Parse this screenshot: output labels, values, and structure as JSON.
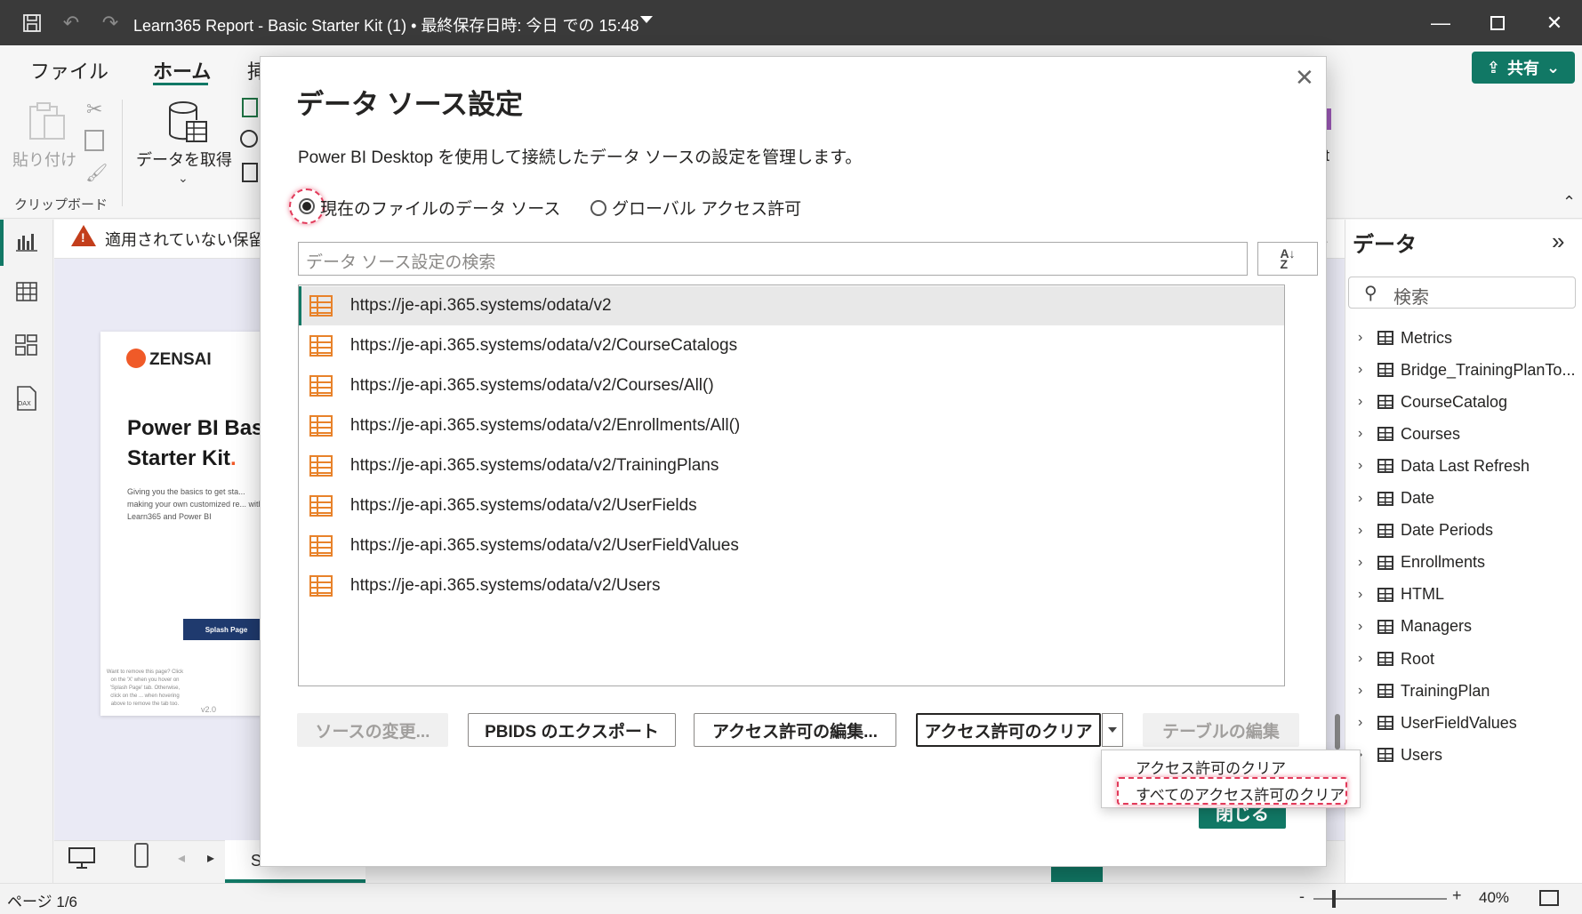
{
  "titlebar": {
    "title": "Learn365 Report - Basic Starter Kit (1) • 最終保存日時: 今日 での 15:48"
  },
  "ribbon": {
    "tabs": [
      "ファイル",
      "ホーム",
      "挿"
    ],
    "paste_label": "貼り付け",
    "get_data_label": "データを取得",
    "clipboard_group": "クリップボード",
    "share_label": "共有",
    "ot_fragment": "ot"
  },
  "canvas": {
    "warning_text": "適用されていない保留",
    "brand": "ZENSAI",
    "report_title_1": "Power BI Bas",
    "report_title_2": "Starter Kit",
    "report_title_dot": ".",
    "description": "Giving you the basics to get sta... making your own customized re... with Learn365 and Power BI",
    "splash_button": "Splash Page",
    "thumb_note": "Want to remove this page? Click on the 'X' when you hover on 'Splash Page' tab. Otherwise, click on the ... when hovering above to remove the tab too.",
    "version": "v2.0"
  },
  "pagebar": {
    "active_tab_fragment": "S"
  },
  "status": {
    "page": "ページ 1/6",
    "zoom": "40%",
    "zoom_fraction": 0.15
  },
  "data_pane": {
    "title": "データ",
    "search_placeholder": "検索",
    "items": [
      {
        "label": "Metrics",
        "icon": "calculator-icon"
      },
      {
        "label": "Bridge_TrainingPlanTo...",
        "icon": "table-icon"
      },
      {
        "label": "CourseCatalog",
        "icon": "table-icon"
      },
      {
        "label": "Courses",
        "icon": "table-icon"
      },
      {
        "label": "Data Last Refresh",
        "icon": "table-icon"
      },
      {
        "label": "Date",
        "icon": "table-icon"
      },
      {
        "label": "Date Periods",
        "icon": "calendar-table-icon"
      },
      {
        "label": "Enrollments",
        "icon": "table-icon"
      },
      {
        "label": "HTML",
        "icon": "table-icon"
      },
      {
        "label": "Managers",
        "icon": "table-icon"
      },
      {
        "label": "Root",
        "icon": "table-icon"
      },
      {
        "label": "TrainingPlan",
        "icon": "table-icon"
      },
      {
        "label": "UserFieldValues",
        "icon": "table-icon"
      },
      {
        "label": "Users",
        "icon": "table-icon"
      }
    ]
  },
  "dialog": {
    "title": "データ ソース設定",
    "description": "Power BI Desktop を使用して接続したデータ ソースの設定を管理します。",
    "radio_current": "現在のファイルのデータ ソース",
    "radio_global": "グローバル アクセス許可",
    "search_placeholder": "データ ソース設定の検索",
    "sources": [
      "https://je-api.365.systems/odata/v2",
      "https://je-api.365.systems/odata/v2/CourseCatalogs",
      "https://je-api.365.systems/odata/v2/Courses/All()",
      "https://je-api.365.systems/odata/v2/Enrollments/All()",
      "https://je-api.365.systems/odata/v2/TrainingPlans",
      "https://je-api.365.systems/odata/v2/UserFields",
      "https://je-api.365.systems/odata/v2/UserFieldValues",
      "https://je-api.365.systems/odata/v2/Users"
    ],
    "buttons": {
      "change_source": "ソースの変更...",
      "export_pbids": "PBIDS のエクスポート",
      "edit_permissions": "アクセス許可の編集...",
      "clear_permissions": "アクセス許可のクリア",
      "edit_tables": "テーブルの編集",
      "close": "閉じる"
    },
    "dropdown": {
      "clear_permissions": "アクセス許可のクリア",
      "clear_all_permissions": "すべてのアクセス許可のクリア"
    }
  },
  "colors": {
    "accent": "#117865",
    "source_icon": "#e8822a",
    "highlight": "#e23a5a",
    "warning": "#c33e1b"
  }
}
